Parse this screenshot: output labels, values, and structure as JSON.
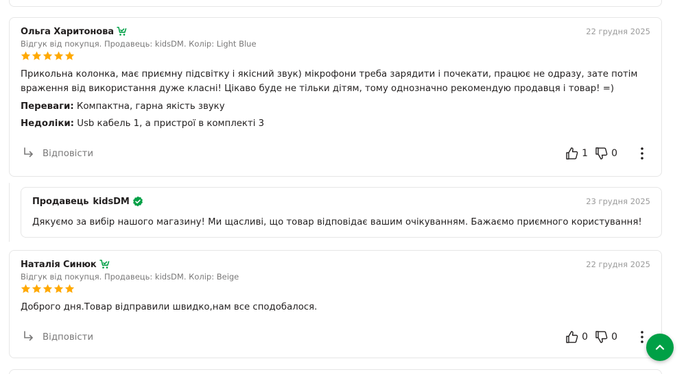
{
  "colors": {
    "accent_green": "#00a046",
    "star": "#ffa900",
    "muted": "#797878",
    "date": "#9b9b9b",
    "border": "#e6e6e6"
  },
  "reviews": [
    {
      "author": "Ольга Харитонова",
      "badge_icon": "buyer-cart-check-icon",
      "date": "22 грудня 2025",
      "meta": "Відгук від покупця. Продавець: kidsDM. Колір: Light Blue",
      "rating": 5,
      "text": "Прикольна колонка, має приємну підсвітку і якісний звук) мікрофони треба зарядити і почекати, працює не одразу, зате потім враження від використання дуже класні! Цікаво буде не тільки дітям, тому однозначно рекомендую продавця і товар! =)",
      "pros_label": "Переваги:",
      "pros_value": "Компактна, гарна якість звуку",
      "cons_label": "Недоліки:",
      "cons_value": "Usb кабель 1, а пристрої в комплекті 3",
      "reply_label": "Відповісти",
      "likes": "1",
      "dislikes": "0"
    },
    {
      "author": "Наталія Синюк",
      "badge_icon": "buyer-cart-check-icon",
      "date": "22 грудня 2025",
      "meta": "Відгук від покупця. Продавець: kidsDM. Колір: Beige",
      "rating": 5,
      "text": "Доброго дня.Товар відправили швидко,нам все сподобалося.",
      "reply_label": "Відповісти",
      "likes": "0",
      "dislikes": "0"
    }
  ],
  "seller_reply": {
    "label": "Продавець",
    "name": "kidsDM",
    "badge_icon": "verified-check-icon",
    "date": "23 грудня 2025",
    "text": "Дякуємо за вибір нашого магазину! Ми щасливі, що товар відповідає вашим очікуванням. Бажаємо приємного користування!"
  },
  "scroll_top_icon": "chevron-up-icon"
}
